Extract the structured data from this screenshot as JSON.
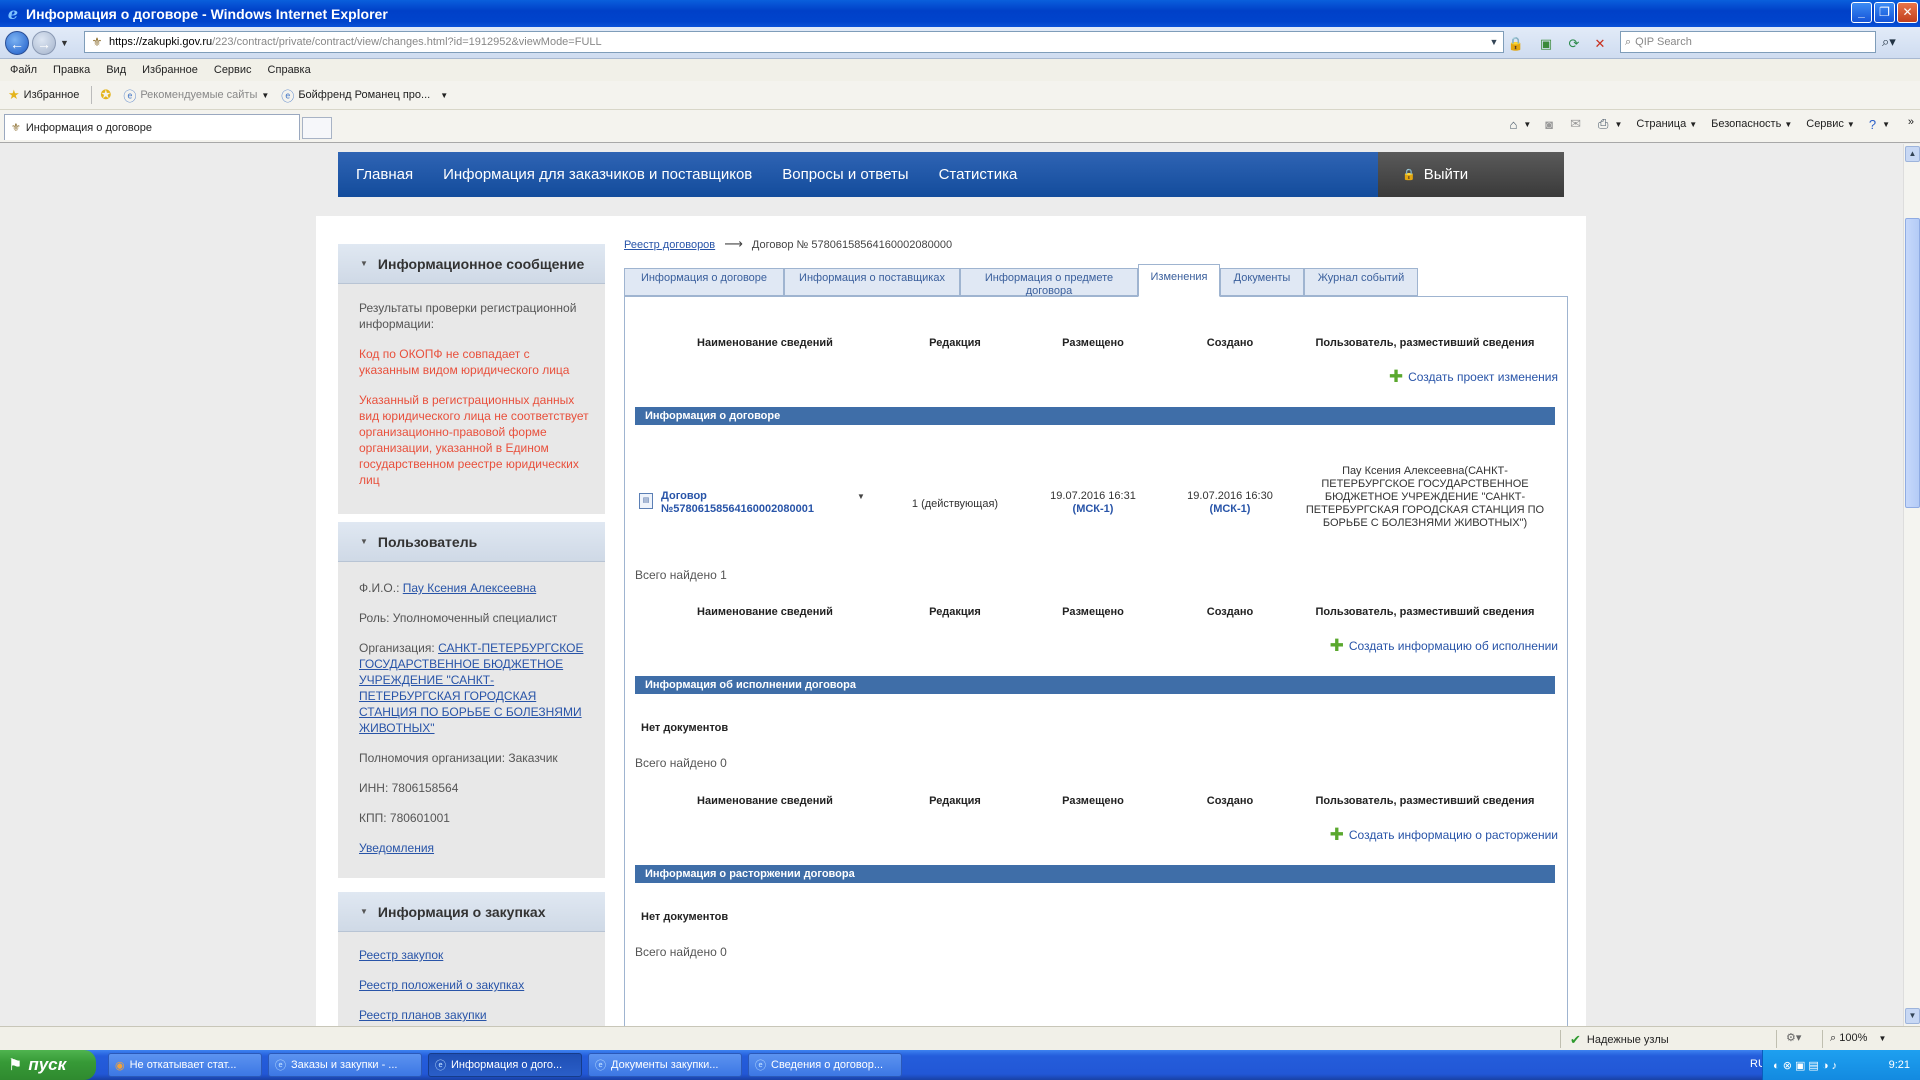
{
  "browser": {
    "window_title": "Информация о договоре - Windows Internet Explorer",
    "url_host": "https://zakupki.gov.ru",
    "url_path": "/223/contract/private/contract/view/changes.html?id=1912952&viewMode=FULL",
    "search_placeholder": "QIP Search",
    "menu": [
      "Файл",
      "Правка",
      "Вид",
      "Избранное",
      "Сервис",
      "Справка"
    ],
    "favorites_label": "Избранное",
    "recommended_sites": "Рекомендуемые сайты",
    "fav_link": "Бойфренд Романец про...",
    "tab_title": "Информация о договоре",
    "commands": {
      "page": "Страница",
      "safety": "Безопасность",
      "tools": "Сервис"
    }
  },
  "site_nav": {
    "links": [
      "Главная",
      "Информация для заказчиков и поставщиков",
      "Вопросы и ответы",
      "Статистика"
    ],
    "logout": "Выйти"
  },
  "sidebar": {
    "info_message": {
      "title": "Информационное сообщение",
      "intro": "Результаты проверки регистрационной информации:",
      "error1": "Код по ОКОПФ не совпадает с указанным видом юридического лица",
      "error2": "Указанный в регистрационных данных вид юридического лица не соответствует организационно-правовой форме организации, указанной в Едином государственном реестре юридических лиц"
    },
    "user": {
      "title": "Пользователь",
      "fio_label": "Ф.И.О.:",
      "fio": "Пау Ксения Алексеевна",
      "role": "Роль: Уполномоченный специалист",
      "org_label": "Организация:",
      "org": "САНКТ-ПЕТЕРБУРГСКОЕ ГОСУДАРСТВЕННОЕ БЮДЖЕТНОЕ УЧРЕЖДЕНИЕ \"САНКТ-ПЕТЕРБУРГСКАЯ ГОРОДСКАЯ СТАНЦИЯ ПО БОРЬБЕ С БОЛЕЗНЯМИ ЖИВОТНЫХ\"",
      "powers": "Полномочия организации: Заказчик",
      "inn": "ИНН: 7806158564",
      "kpp": "КПП: 780601001",
      "notifications": "Уведомления"
    },
    "purchases": {
      "title": "Информация о закупках",
      "links": [
        "Реестр закупок",
        "Реестр положений о закупках",
        "Реестр планов закупки"
      ]
    }
  },
  "main": {
    "breadcrumb_link": "Реестр договоров",
    "breadcrumb_current": "Договор № 57806158564160002080000",
    "tabs": [
      "Информация о договоре",
      "Информация о поставщиках",
      "Информация о предмете договора",
      "Изменения",
      "Документы",
      "Журнал событий"
    ],
    "columns": {
      "name": "Наименование сведений",
      "edition": "Редакция",
      "posted": "Размещено",
      "created": "Создано",
      "user": "Пользователь, разместивший сведения"
    },
    "create_change": "Создать проект изменения",
    "section1": "Информация о договоре",
    "row": {
      "doc_title": "Договор",
      "doc_number": "№57806158564160002080001",
      "edition": "1 (действующая)",
      "posted_date": "19.07.2016 16:31",
      "posted_tz": "(МСК-1)",
      "created_date": "19.07.2016 16:30",
      "created_tz": "(МСК-1)",
      "user": "Пау Ксения Алексеевна(САНКТ-ПЕТЕРБУРГСКОЕ ГОСУДАРСТВЕННОЕ БЮДЖЕТНОЕ УЧРЕЖДЕНИЕ \"САНКТ-ПЕТЕРБУРГСКАЯ ГОРОДСКАЯ СТАНЦИЯ ПО БОРЬБЕ С БОЛЕЗНЯМИ ЖИВОТНЫХ\")"
    },
    "found1": "Всего найдено 1",
    "create_execution": "Создать информацию об исполнении",
    "section2": "Информация об исполнении договора",
    "no_docs": "Нет документов",
    "found0": "Всего найдено 0",
    "create_termination": "Создать информацию о расторжении",
    "section3": "Информация о расторжении договора"
  },
  "statusbar": {
    "zone": "Надежные узлы",
    "zoom": "100%"
  },
  "taskbar": {
    "start": "пуск",
    "tasks": [
      "Не откатывает стат...",
      "Заказы и закупки - ...",
      "Информация о дого...",
      "Документы закупки...",
      "Сведения о договор..."
    ],
    "lang": "RU",
    "clock": "9:21"
  }
}
